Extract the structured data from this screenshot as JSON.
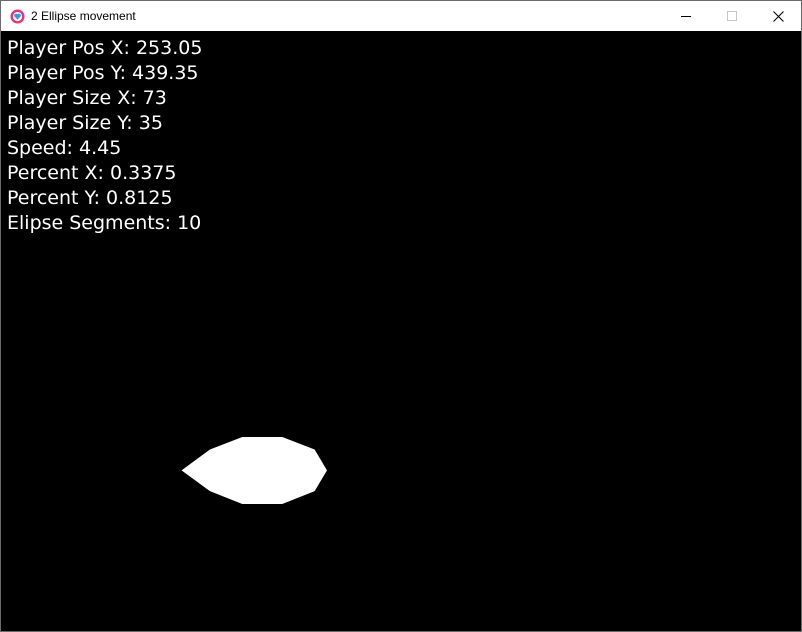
{
  "window": {
    "title": "2 Ellipse movement",
    "controls": {
      "minimize_icon": "minimize-icon",
      "maximize_icon": "maximize-icon",
      "close_icon": "close-icon"
    }
  },
  "colors": {
    "background": "#000000",
    "text": "#ffffff",
    "player": "#ffffff",
    "icon_outer": "#e8337a",
    "icon_inner": "#2f9be0"
  },
  "hud": [
    {
      "label": "Player Pos X: 253.05"
    },
    {
      "label": "Player Pos Y: 439.35"
    },
    {
      "label": "Player Size X: 73"
    },
    {
      "label": "Player Size Y: 35"
    },
    {
      "label": "Speed: 4.45"
    },
    {
      "label": "Percent X: 0.3375"
    },
    {
      "label": "Percent Y: 0.8125"
    },
    {
      "label": "Elipse Segments: 10"
    }
  ]
}
